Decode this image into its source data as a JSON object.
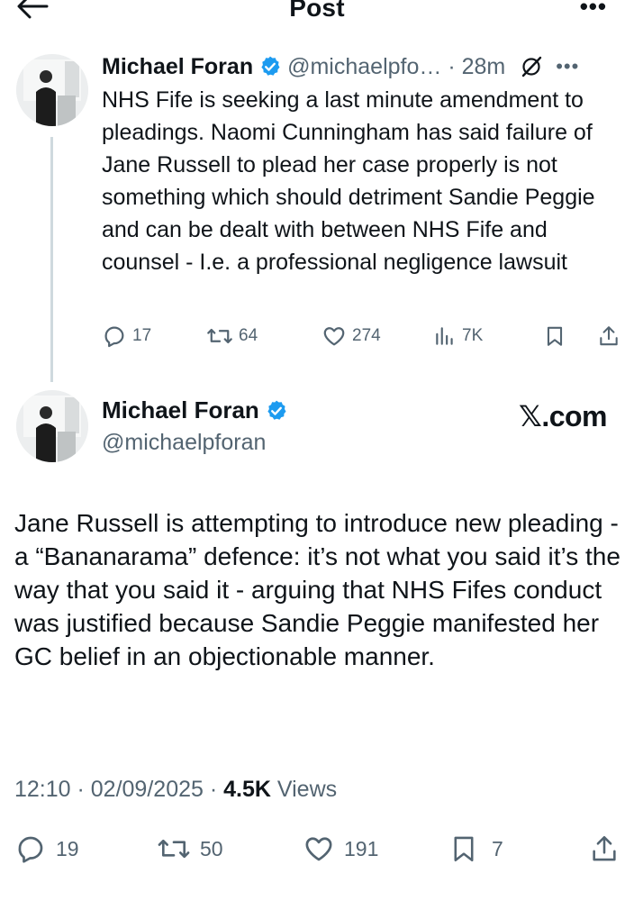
{
  "header": {
    "title": "Post"
  },
  "parent_tweet": {
    "name": "Michael Foran",
    "handle_time": "@michaelpfo… · 28m",
    "text": "NHS Fife is seeking a last minute amendment to pleadings. Naomi Cunningham has said failure of Jane Russell to plead her case properly is not something which should detriment Sandie Peggie and can be dealt with between NHS Fife and counsel - I.e. a professional negligence lawsuit",
    "stats": {
      "replies": "17",
      "reposts": "64",
      "likes": "274",
      "views": "7K"
    }
  },
  "main_tweet": {
    "name": "Michael Foran",
    "handle": "@michaelpforan",
    "brand": "𝕏.com",
    "text": "Jane Russell is attempting to introduce new pleading - a “Bananarama” defence: it’s not what you said it’s the way that you said it - arguing that NHS Fifes conduct was justified because Sandie Peggie manifested her GC belief in an objectionable manner.",
    "meta_time": "12:10 · 02/09/2025 · ",
    "meta_views_count": "4.5K",
    "meta_views_label": " Views",
    "stats": {
      "replies": "19",
      "reposts": "50",
      "likes": "191",
      "bookmarks": "7"
    }
  },
  "colors": {
    "verified": "#1d9bf0",
    "muted": "#536471",
    "text": "#0f1419",
    "thread_line": "#cfd9de"
  }
}
